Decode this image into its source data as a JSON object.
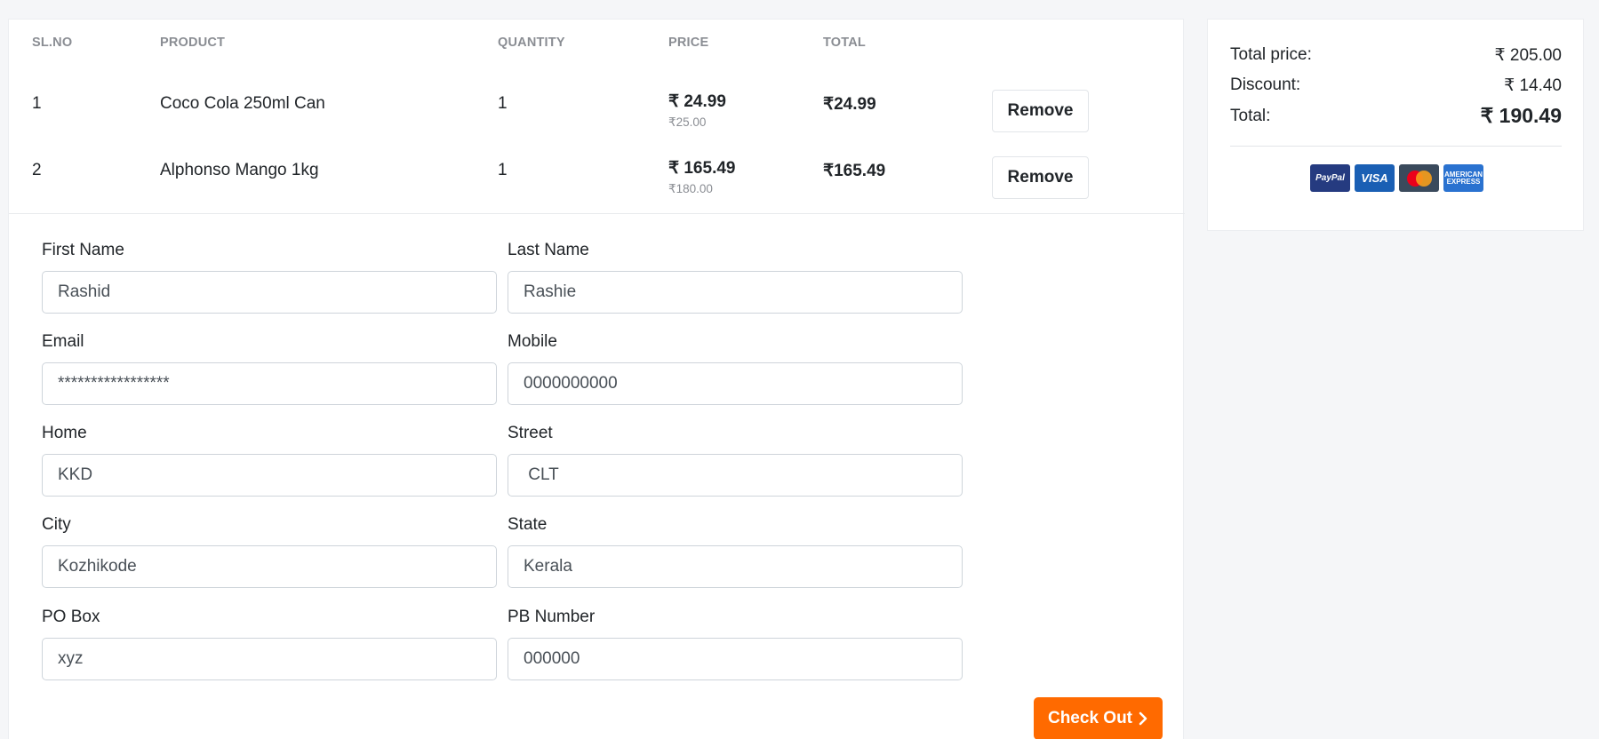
{
  "cart": {
    "headers": {
      "sl": "SL.NO",
      "product": "PRODUCT",
      "quantity": "QUANTITY",
      "price": "PRICE",
      "total": "TOTAL"
    },
    "rows": [
      {
        "sl": "1",
        "product": "Coco Cola 250ml Can",
        "quantity": "1",
        "price": "₹ 24.99",
        "old_price": "₹25.00",
        "total": "₹24.99",
        "remove": "Remove"
      },
      {
        "sl": "2",
        "product": "Alphonso Mango 1kg",
        "quantity": "1",
        "price": "₹ 165.49",
        "old_price": "₹180.00",
        "total": "₹165.49",
        "remove": "Remove"
      }
    ]
  },
  "form": {
    "first_name": {
      "label": "First Name",
      "value": "Rashid"
    },
    "last_name": {
      "label": "Last Name",
      "value": "Rashie"
    },
    "email": {
      "label": "Email",
      "value": "*****************"
    },
    "mobile": {
      "label": "Mobile",
      "value": "0000000000"
    },
    "home": {
      "label": "Home",
      "value": "KKD"
    },
    "street": {
      "label": "Street",
      "value": " CLT"
    },
    "city": {
      "label": "City",
      "value": "Kozhikode"
    },
    "state": {
      "label": "State",
      "value": "Kerala"
    },
    "po_box": {
      "label": "PO Box",
      "value": "xyz"
    },
    "pb_number": {
      "label": "PB Number",
      "value": "000000"
    },
    "checkout_label": "Check Out"
  },
  "summary": {
    "total_price_label": "Total price:",
    "total_price_value": "₹ 205.00",
    "discount_label": "Discount:",
    "discount_value": "₹ 14.40",
    "total_label": "Total:",
    "total_value": "₹ 190.49",
    "payment_icons": {
      "paypal": "PayPal",
      "visa": "VISA",
      "mastercard": "mastercard-icon",
      "amex_line1": "AMERICAN",
      "amex_line2": "EXPRESS"
    }
  },
  "colors": {
    "accent": "#ff6a00",
    "background": "#f5f6f8"
  }
}
